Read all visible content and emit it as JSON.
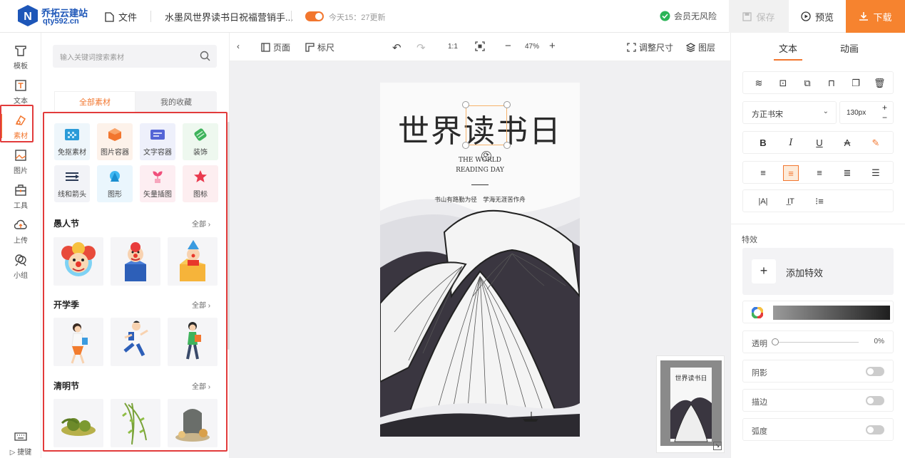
{
  "topbar": {
    "logo_name": "乔拓云建站",
    "logo_url": "qty592.cn",
    "file_label": "文件",
    "doc_title": "水墨风世界读书日祝福营销手...",
    "update_text": "今天15：27更新",
    "safe_text": "会员无风险",
    "save_label": "保存",
    "preview_label": "预览",
    "download_label": "下载"
  },
  "leftnav": {
    "items": [
      {
        "label": "模板",
        "icon": "template-icon"
      },
      {
        "label": "文本",
        "icon": "text-icon"
      },
      {
        "label": "素材",
        "icon": "material-icon"
      },
      {
        "label": "图片",
        "icon": "image-icon"
      },
      {
        "label": "工具",
        "icon": "toolbox-icon"
      },
      {
        "label": "上传",
        "icon": "upload-icon"
      },
      {
        "label": "小组",
        "icon": "team-icon"
      }
    ],
    "shortcut_label": "捷键"
  },
  "panel": {
    "search_placeholder": "输入关键词搜索素材",
    "tabs": [
      "全部素材",
      "我的收藏"
    ],
    "materials": [
      "免抠素材",
      "图片容器",
      "文字容器",
      "装饰",
      "线和箭头",
      "图形",
      "矢量插图",
      "图标"
    ],
    "sections": [
      {
        "title": "愚人节",
        "all": "全部"
      },
      {
        "title": "开学季",
        "all": "全部"
      },
      {
        "title": "清明节",
        "all": "全部"
      }
    ]
  },
  "canvasbar": {
    "page_label": "页面",
    "ruler_label": "标尺",
    "ratio_label": "1:1",
    "zoom": "47%",
    "resize_label": "调整尺寸",
    "layers_label": "图层"
  },
  "poster": {
    "title": "世界读书日",
    "subtitle_line1": "THE WORLD",
    "subtitle_line2": "READING DAY",
    "slogan": "书山有路勤为径　学海无涯苦作舟"
  },
  "rightpanel": {
    "tabs": [
      "文本",
      "动画"
    ],
    "font_name": "方正书宋",
    "font_size": "130px",
    "effects_label": "特效",
    "add_effect_label": "添加特效",
    "opacity_label": "透明",
    "opacity_value": "0%",
    "shadow_label": "阴影",
    "stroke_label": "描边",
    "arc_label": "弧度"
  },
  "colors": {
    "accent": "#f2762e",
    "brand": "#1d56b8",
    "highlight_red": "#e23b3b"
  }
}
